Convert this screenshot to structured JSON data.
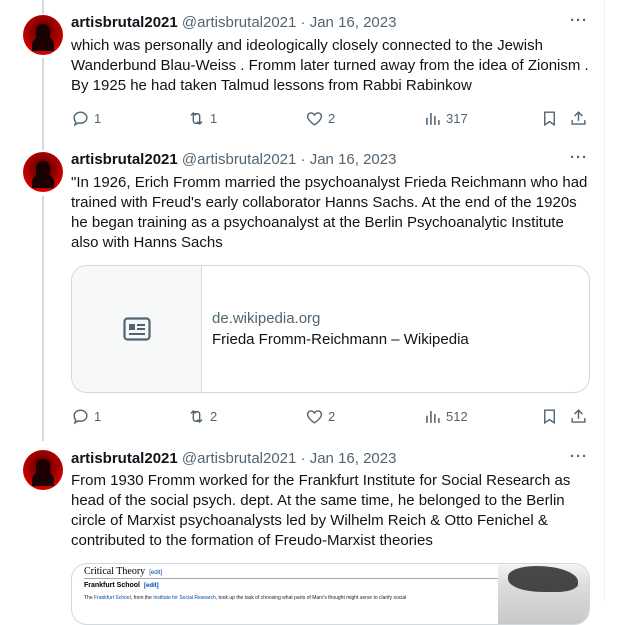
{
  "tweets": [
    {
      "name": "artisbrutal2021",
      "handle": "@artisbrutal2021",
      "date": "Jan 16, 2023",
      "separator": "·",
      "text": "which was personally and ideologically closely connected to the Jewish Wanderbund Blau-Weiss . Fromm later turned away from the idea of Zionism .  By 1925 he had taken Talmud lessons from Rabbi Rabinkow",
      "replies": "1",
      "retweets": "1",
      "likes": "2",
      "views": "317"
    },
    {
      "name": "artisbrutal2021",
      "handle": "@artisbrutal2021",
      "date": "Jan 16, 2023",
      "separator": "·",
      "text": "\"In 1926, Erich Fromm married the psychoanalyst Frieda Reichmann who had trained with Freud's early collaborator Hanns Sachs. At the end of the 1920s he began training as a psychoanalyst at the Berlin Psychoanalytic Institute also with Hanns Sachs",
      "link_card": {
        "domain": "de.wikipedia.org",
        "title": "Frieda Fromm-Reichmann – Wikipedia"
      },
      "replies": "1",
      "retweets": "2",
      "likes": "2",
      "views": "512"
    },
    {
      "name": "artisbrutal2021",
      "handle": "@artisbrutal2021",
      "date": "Jan 16, 2023",
      "separator": "·",
      "text": "From 1930 Fromm worked for the Frankfurt Institute for Social Research as head of the social psych. dept.  At the same time, he belonged to the Berlin circle of Marxist psychoanalysts led by Wilhelm Reich & Otto Fenichel & contributed to the formation of Freudo-Marxist theories",
      "image_card": {
        "heading": "Critical Theory",
        "edit": "[edit]",
        "subheading": "Frankfurt School",
        "text_pre": "The ",
        "link1": "Frankfurt School",
        "text_mid": ", from the ",
        "link2": "Institute for Social Research",
        "text_post": ", took up the task of choosing what parts of Marx's thought might serve to clarify social"
      }
    }
  ],
  "icons": {
    "reply": "reply-icon",
    "retweet": "retweet-icon",
    "like": "like-icon",
    "views": "views-icon",
    "bookmark": "bookmark-icon",
    "share": "share-icon",
    "more": "more-icon"
  },
  "colors": {
    "text": "#0f1419",
    "secondary": "#536471",
    "border": "#cfd9de",
    "avatar": "#d10000"
  }
}
